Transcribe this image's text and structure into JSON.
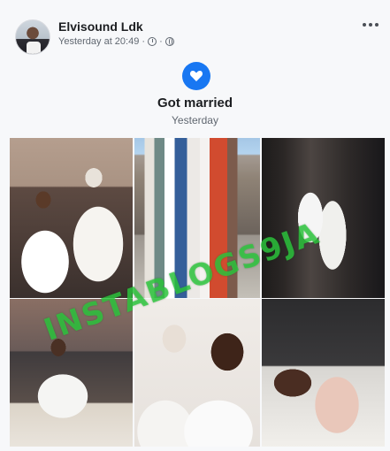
{
  "post": {
    "author": "Elvisound Ldk",
    "timestamp": "Yesterday at 20:49 ·",
    "timestamp_icon": "clock-icon",
    "privacy_icon": "globe-icon",
    "more_icon": "more-options-icon"
  },
  "event": {
    "icon": "heart-hands-icon",
    "accent": "#1877f2",
    "title": "Got married",
    "subtitle": "Yesterday"
  },
  "photos": [
    {
      "name": "couple-on-sofa"
    },
    {
      "name": "group-photo"
    },
    {
      "name": "couple-dancing"
    },
    {
      "name": "signing-register"
    },
    {
      "name": "couple-selfie"
    },
    {
      "name": "hands-with-rings"
    }
  ],
  "watermark": "INSTABLOGS9JA"
}
